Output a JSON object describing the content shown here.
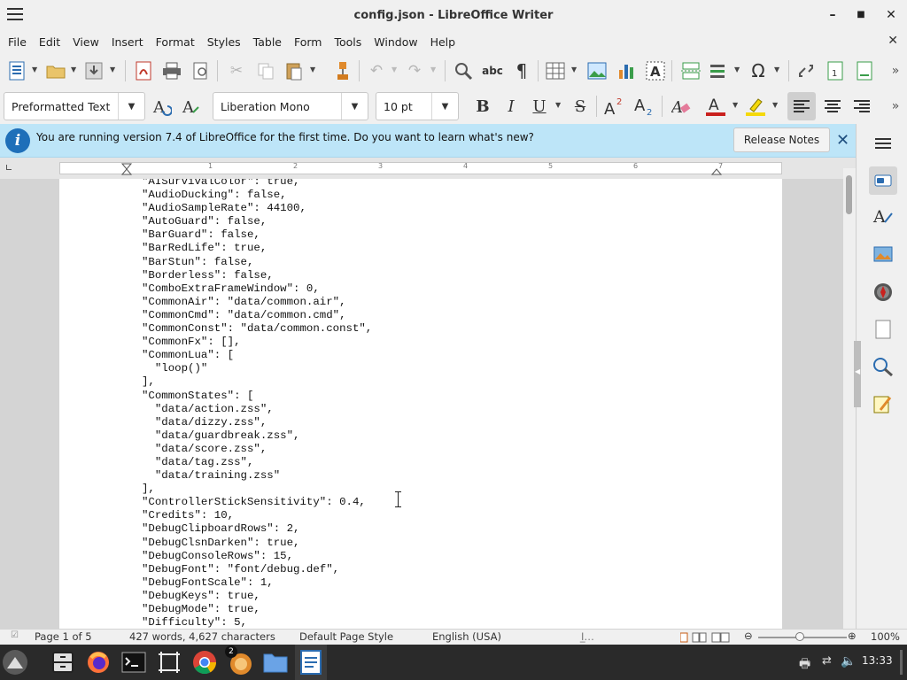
{
  "window": {
    "title": "config.json - LibreOffice Writer"
  },
  "menu": [
    "File",
    "Edit",
    "View",
    "Insert",
    "Format",
    "Styles",
    "Table",
    "Form",
    "Tools",
    "Window",
    "Help"
  ],
  "formatting": {
    "paragraph_style": "Preformatted Text",
    "font_name": "Liberation Mono",
    "font_size": "10 pt"
  },
  "infobar": {
    "message": "You are running version 7.4 of LibreOffice for the first time. Do you want to learn what's new?",
    "button": "Release Notes"
  },
  "ruler": {
    "numbers": [
      "1",
      "2",
      "3",
      "4",
      "5",
      "6",
      "7"
    ]
  },
  "document": {
    "lines": [
      "\"AISurvivalColor\": true,",
      "\"AudioDucking\": false,",
      "\"AudioSampleRate\": 44100,",
      "\"AutoGuard\": false,",
      "\"BarGuard\": false,",
      "\"BarRedLife\": true,",
      "\"BarStun\": false,",
      "\"Borderless\": false,",
      "\"ComboExtraFrameWindow\": 0,",
      "\"CommonAir\": \"data/common.air\",",
      "\"CommonCmd\": \"data/common.cmd\",",
      "\"CommonConst\": \"data/common.const\",",
      "\"CommonFx\": [],",
      "\"CommonLua\": [",
      "  \"loop()\"",
      "],",
      "\"CommonStates\": [",
      "  \"data/action.zss\",",
      "  \"data/dizzy.zss\",",
      "  \"data/guardbreak.zss\",",
      "  \"data/score.zss\",",
      "  \"data/tag.zss\",",
      "  \"data/training.zss\"",
      "],",
      "\"ControllerStickSensitivity\": 0.4,",
      "\"Credits\": 10,",
      "\"DebugClipboardRows\": 2,",
      "\"DebugClsnDarken\": true,",
      "\"DebugConsoleRows\": 15,",
      "\"DebugFont\": \"font/debug.def\",",
      "\"DebugFontScale\": 1,",
      "\"DebugKeys\": true,",
      "\"DebugMode\": true,",
      "\"Difficulty\": 5,"
    ]
  },
  "status": {
    "page": "Page 1 of 5",
    "words": "427 words, 4,627 characters",
    "page_style": "Default Page Style",
    "language": "English (USA)",
    "zoom": "100%"
  },
  "taskbar": {
    "badge": "2",
    "clock": "13:33"
  },
  "colors": {
    "infobar_bg": "#bde5f8",
    "info_icon": "#1e6fb9",
    "taskbar_bg": "#2a2a2a"
  }
}
